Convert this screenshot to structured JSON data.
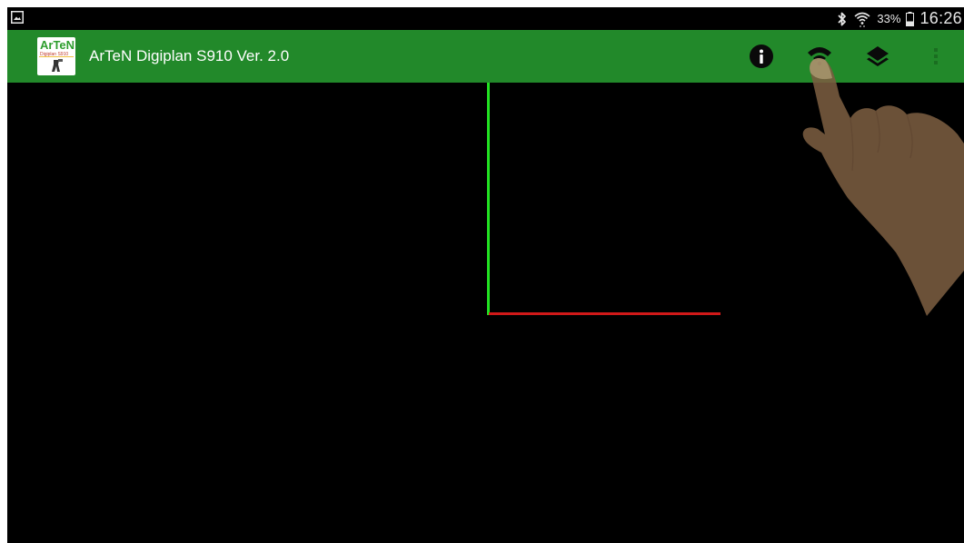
{
  "status_bar": {
    "left_icon": "gallery-notification-icon",
    "bluetooth_icon": "bluetooth-icon",
    "wifi_icon": "wifi-icon",
    "battery_percent": "33%",
    "battery_icon": "battery-icon",
    "time": "16:26"
  },
  "action_bar": {
    "title": "ArTeN Digiplan S910 Ver. 2.0",
    "logo_text": "ArTeN",
    "logo_subtext": "Digiplan S910",
    "info_icon": "info-icon",
    "connect_icon": "wireless-connect-icon",
    "layers_icon": "layers-icon",
    "overflow_icon": "overflow-menu-icon"
  },
  "colors": {
    "action_bar_bg": "#22892a",
    "canvas_bg": "#000000",
    "y_axis": "#22e322",
    "x_axis": "#d11919",
    "hand": "#7a5c40"
  }
}
